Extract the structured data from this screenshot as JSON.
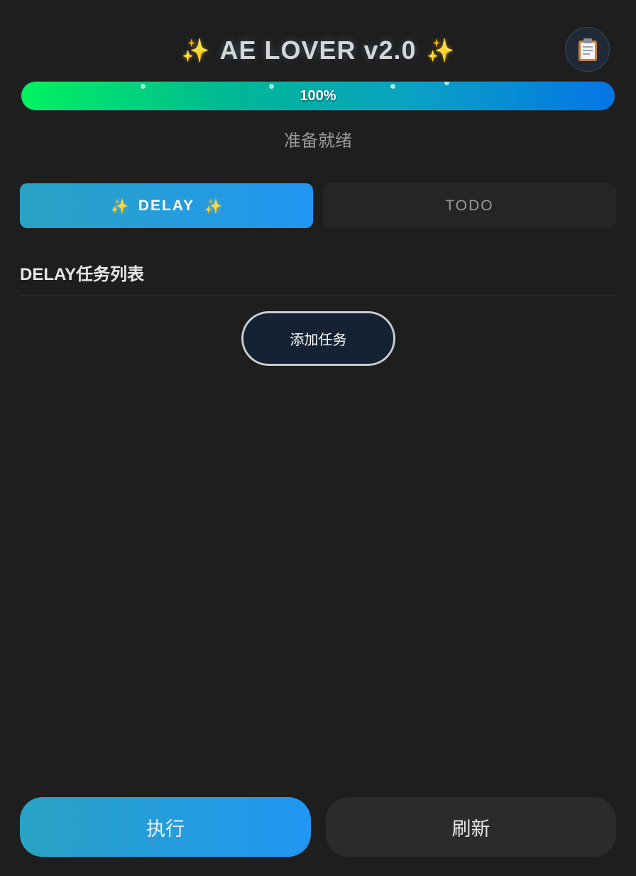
{
  "header": {
    "title": "AE LOVER v2.0",
    "sparkle": "✨",
    "log_icon": "clipboard-icon"
  },
  "progress": {
    "value": 100,
    "label": "100%",
    "gradient": [
      "#00f260",
      "#0575e6"
    ]
  },
  "status_text": "准备就绪",
  "tabs": [
    {
      "label": "DELAY",
      "active": true
    },
    {
      "label": "TODO",
      "active": false
    }
  ],
  "section": {
    "title": "DELAY任务列表",
    "add_button": "添加任务"
  },
  "actions": {
    "execute": "执行",
    "refresh": "刷新"
  },
  "colors": {
    "background": "#1e1e1e",
    "accent": "#2196f3",
    "accent_alt": "#29a3c4"
  }
}
